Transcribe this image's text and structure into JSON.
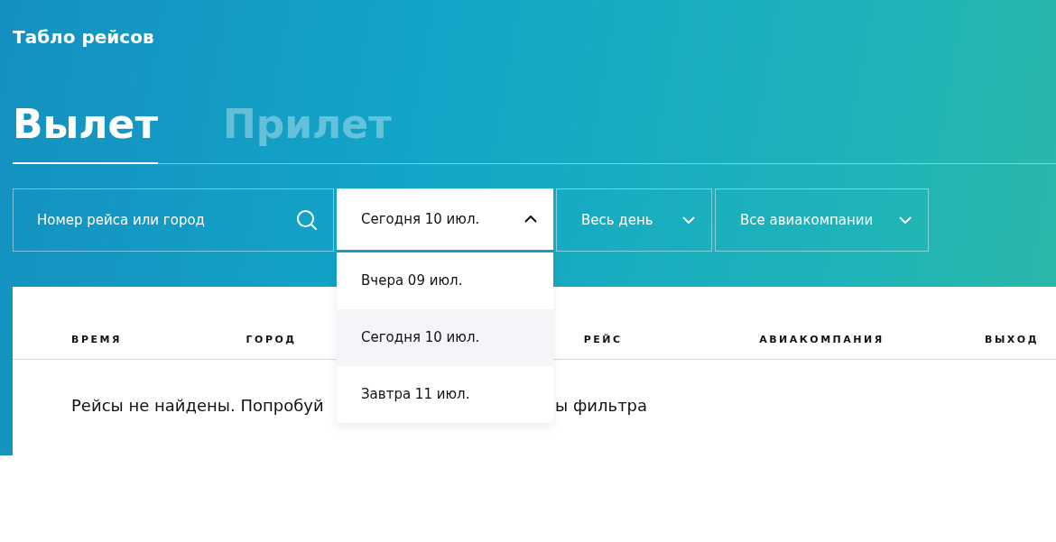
{
  "page_title": "Табло рейсов",
  "tabs": [
    {
      "label": "Вылет",
      "selected": true
    },
    {
      "label": "Прилет",
      "selected": false
    }
  ],
  "search": {
    "placeholder": "Номер рейса или город"
  },
  "filters": [
    {
      "value": "Сегодня 10 июл.",
      "expanded": true
    },
    {
      "value": "Весь день",
      "expanded": false
    },
    {
      "value": "Все авиакомпании",
      "expanded": false
    }
  ],
  "date_options": [
    {
      "label": "Вчера 09 июл.",
      "selected": false
    },
    {
      "label": "Сегодня 10 июл.",
      "selected": true
    },
    {
      "label": "Завтра 11 июл.",
      "selected": false
    }
  ],
  "table": {
    "columns": [
      "ВРЕМЯ",
      "ГОРОД",
      "РЕЙС",
      "АВИАКОМПАНИЯ",
      "ВЫХОД"
    ],
    "empty_message_parts": [
      "Рейсы не найдены. Попробуй",
      "ы фильтра"
    ]
  }
}
